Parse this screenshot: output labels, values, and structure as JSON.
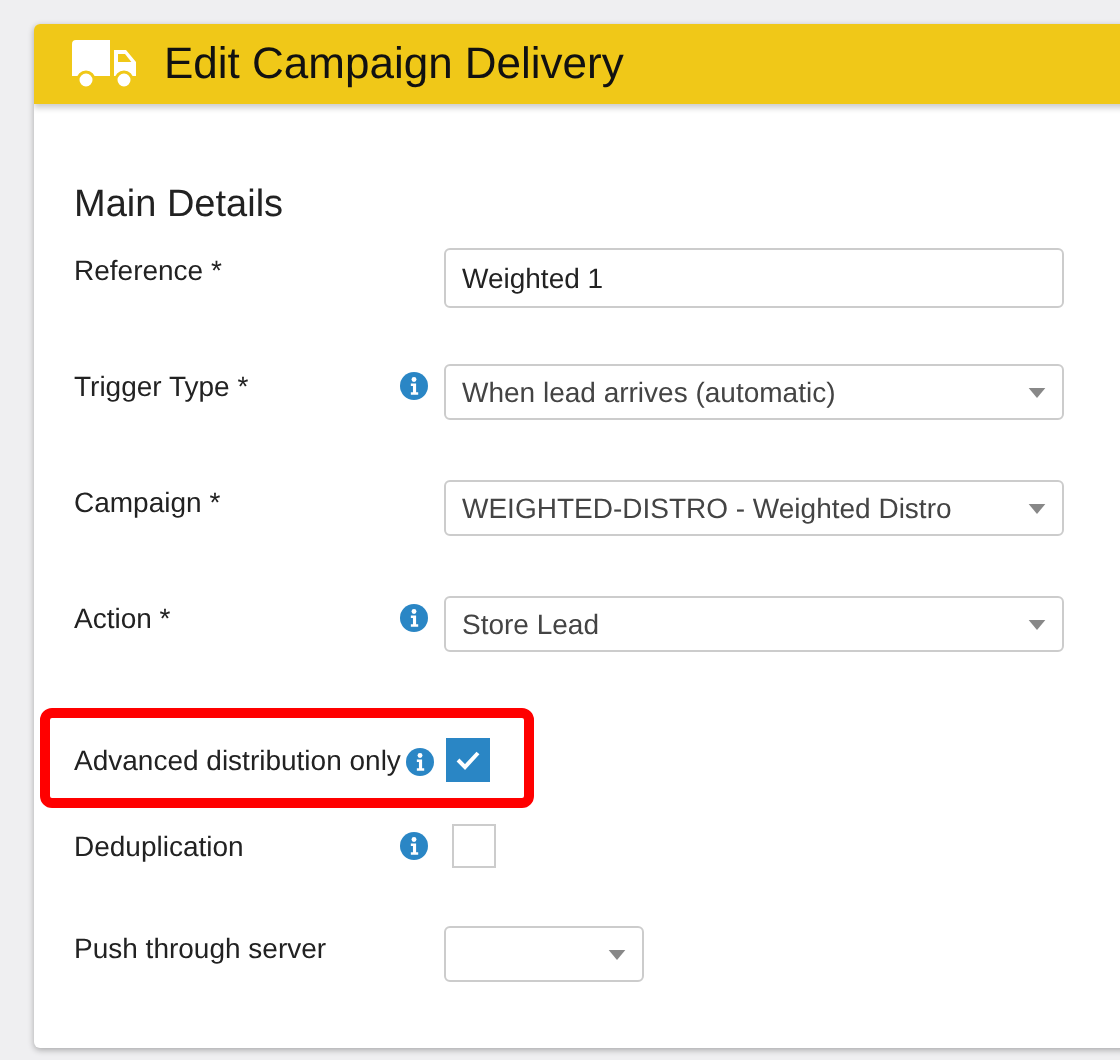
{
  "header": {
    "title": "Edit Campaign Delivery"
  },
  "section": {
    "title": "Main Details"
  },
  "fields": [
    {
      "kind": "text",
      "label": "Reference *",
      "info": false,
      "value": "Weighted 1"
    },
    {
      "kind": "select",
      "label": "Trigger Type *",
      "info": true,
      "value": "When lead arrives (automatic)"
    },
    {
      "kind": "select",
      "label": "Campaign *",
      "info": false,
      "value": "WEIGHTED-DISTRO - Weighted Distro"
    },
    {
      "kind": "select",
      "label": "Action *",
      "info": true,
      "value": "Store Lead"
    },
    {
      "kind": "checkbox",
      "label": "Advanced distribution only",
      "info": true,
      "checked": true,
      "highlighted": true
    },
    {
      "kind": "checkbox",
      "label": "Deduplication",
      "info": true,
      "checked": false,
      "highlighted": false
    },
    {
      "kind": "small-select",
      "label": "Push through server",
      "info": false
    }
  ]
}
